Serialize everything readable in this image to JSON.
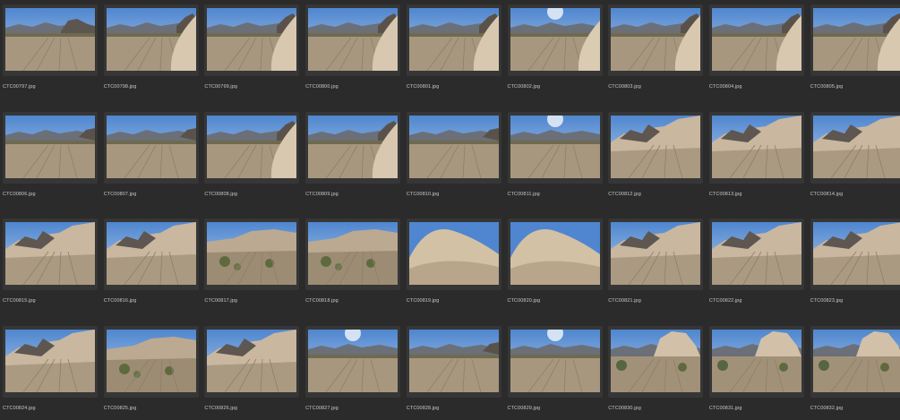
{
  "thumbnails": [
    {
      "file": "CTC00797.jpg",
      "scene": "left-rock"
    },
    {
      "file": "CTC00798.jpg",
      "scene": "right-slab"
    },
    {
      "file": "CTC00799.jpg",
      "scene": "right-slab"
    },
    {
      "file": "CTC00800.jpg",
      "scene": "right-slab"
    },
    {
      "file": "CTC00801.jpg",
      "scene": "right-slab"
    },
    {
      "file": "CTC00802.jpg",
      "scene": "sun-slab"
    },
    {
      "file": "CTC00803.jpg",
      "scene": "right-slab"
    },
    {
      "file": "CTC00804.jpg",
      "scene": "right-slab"
    },
    {
      "file": "CTC00805.jpg",
      "scene": "right-slab"
    },
    {
      "file": "CTC00806.jpg",
      "scene": "wash"
    },
    {
      "file": "CTC00807.jpg",
      "scene": "wash"
    },
    {
      "file": "CTC00808.jpg",
      "scene": "right-slab"
    },
    {
      "file": "CTC00809.jpg",
      "scene": "right-slab"
    },
    {
      "file": "CTC00810.jpg",
      "scene": "wash"
    },
    {
      "file": "CTC00811.jpg",
      "scene": "sun-wash"
    },
    {
      "file": "CTC00812.jpg",
      "scene": "cliffs"
    },
    {
      "file": "CTC00813.jpg",
      "scene": "cliffs"
    },
    {
      "file": "CTC00814.jpg",
      "scene": "cliffs"
    },
    {
      "file": "CTC00815.jpg",
      "scene": "cliffs"
    },
    {
      "file": "CTC00816.jpg",
      "scene": "cliffs"
    },
    {
      "file": "CTC00817.jpg",
      "scene": "bushes"
    },
    {
      "file": "CTC00818.jpg",
      "scene": "bushes"
    },
    {
      "file": "CTC00819.jpg",
      "scene": "dune"
    },
    {
      "file": "CTC00820.jpg",
      "scene": "dune"
    },
    {
      "file": "CTC00821.jpg",
      "scene": "cliffs"
    },
    {
      "file": "CTC00822.jpg",
      "scene": "cliffs"
    },
    {
      "file": "CTC00823.jpg",
      "scene": "cliffs"
    },
    {
      "file": "CTC00824.jpg",
      "scene": "cliffs"
    },
    {
      "file": "CTC00825.jpg",
      "scene": "bushes"
    },
    {
      "file": "CTC00826.jpg",
      "scene": "cliffs"
    },
    {
      "file": "CTC00827.jpg",
      "scene": "sun-wash"
    },
    {
      "file": "CTC00828.jpg",
      "scene": "wash"
    },
    {
      "file": "CTC00829.jpg",
      "scene": "sun-wash"
    },
    {
      "file": "CTC00830.jpg",
      "scene": "boulder"
    },
    {
      "file": "CTC00831.jpg",
      "scene": "boulder"
    },
    {
      "file": "CTC00832.jpg",
      "scene": "boulder"
    }
  ],
  "colors": {
    "background": "#2b2b2b",
    "frame": "#363636",
    "label": "#c8c8c8",
    "sky": "#6f9fd8",
    "sand": "#b3a18a",
    "rock": "#d9c9b0"
  }
}
